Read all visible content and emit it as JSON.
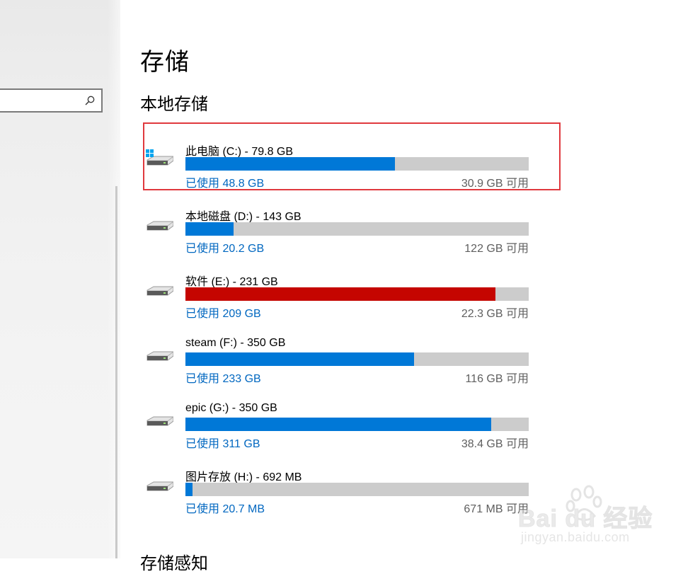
{
  "page": {
    "title": "存储",
    "section_local": "本地存储",
    "section_next": "存储感知"
  },
  "search": {
    "placeholder": ""
  },
  "drives": [
    {
      "name": "此电脑 (C:) - 79.8 GB",
      "used": "已使用 48.8 GB",
      "free": "30.9 GB 可用",
      "fraction_used": 0.611,
      "status": "normal",
      "icon": "system-drive-icon"
    },
    {
      "name": "本地磁盘 (D:) - 143 GB",
      "used": "已使用 20.2 GB",
      "free": "122 GB 可用",
      "fraction_used": 0.141,
      "status": "normal",
      "icon": "drive-icon"
    },
    {
      "name": "软件 (E:) - 231 GB",
      "used": "已使用 209 GB",
      "free": "22.3 GB 可用",
      "fraction_used": 0.903,
      "status": "critical",
      "icon": "drive-icon"
    },
    {
      "name": "steam (F:) - 350 GB",
      "used": "已使用 233 GB",
      "free": "116 GB 可用",
      "fraction_used": 0.667,
      "status": "normal",
      "icon": "drive-icon"
    },
    {
      "name": "epic (G:) - 350 GB",
      "used": "已使用 311 GB",
      "free": "38.4 GB 可用",
      "fraction_used": 0.89,
      "status": "normal",
      "icon": "drive-icon"
    },
    {
      "name": "图片存放 (H:) - 692 MB",
      "used": "已使用 20.7 MB",
      "free": "671 MB 可用",
      "fraction_used": 0.02,
      "status": "normal",
      "icon": "drive-icon"
    }
  ],
  "colors": {
    "accent": "#0078d7",
    "critical": "#c50500",
    "track": "#cccccc",
    "highlight_border": "#e0393e"
  },
  "watermark": {
    "brand": "Bai du 经验",
    "url": "jingyan.baidu.com"
  }
}
